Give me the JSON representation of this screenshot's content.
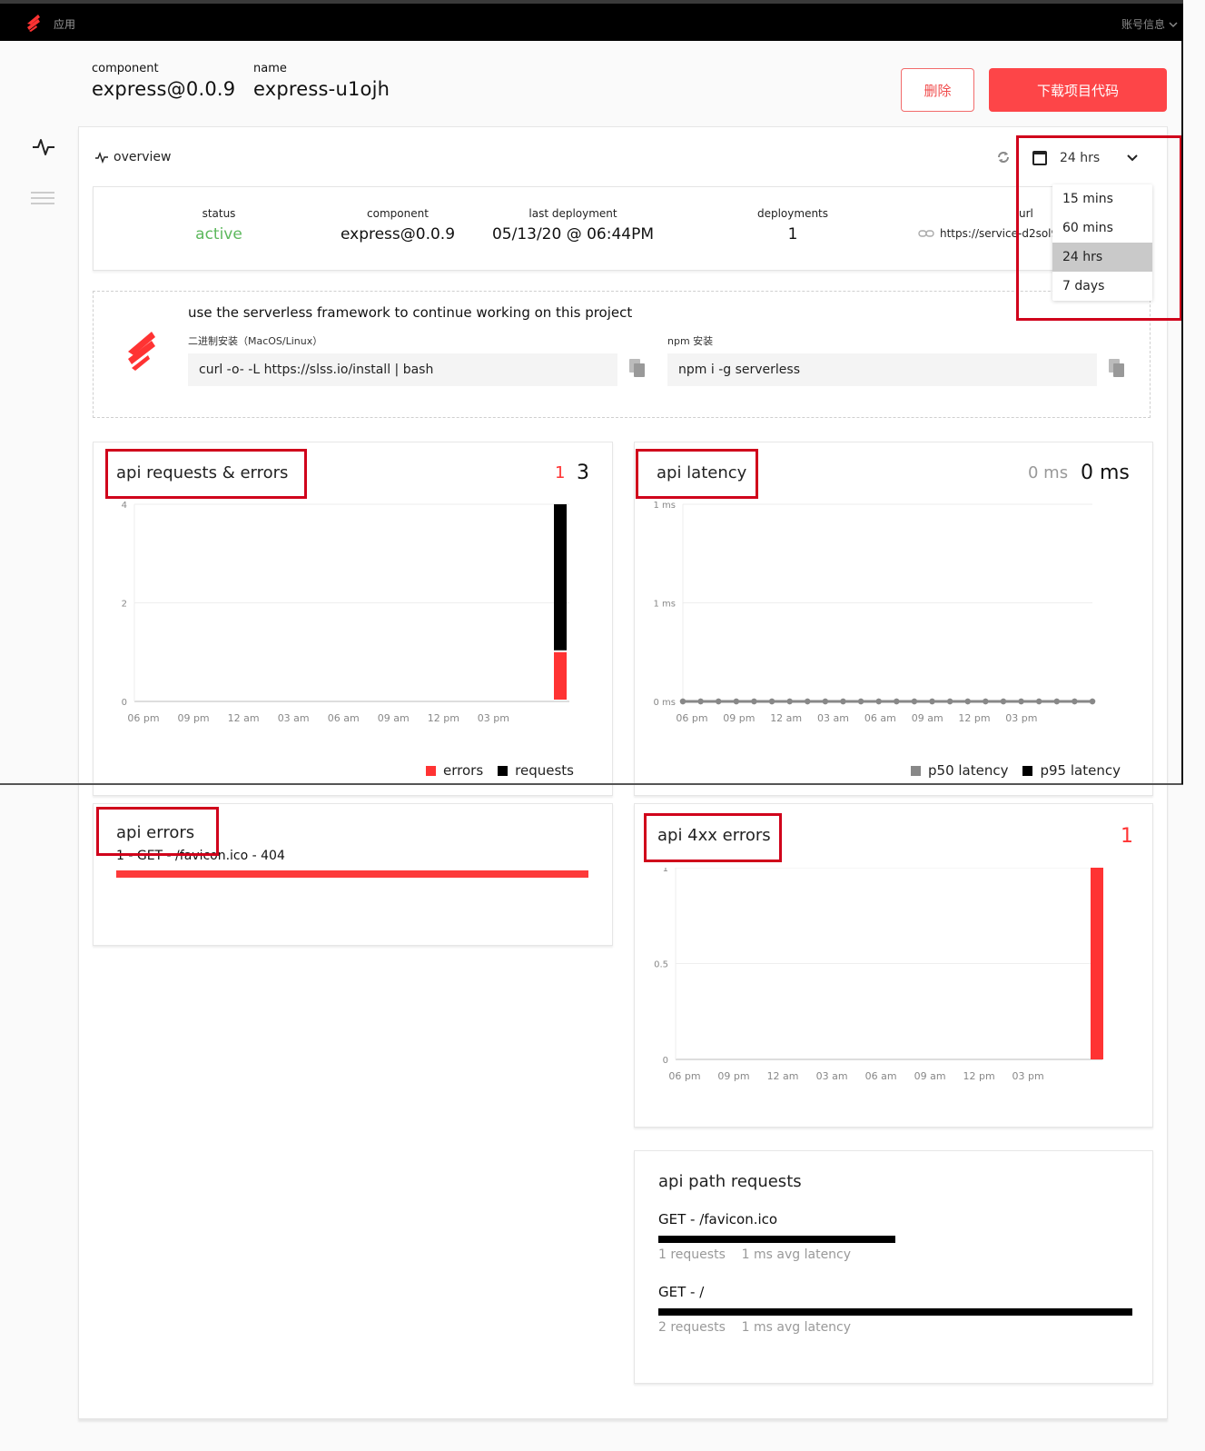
{
  "topbar": {
    "app_label": "应用",
    "account_label": "账号信息"
  },
  "header": {
    "component_label": "component",
    "component_value": "express@0.0.9",
    "name_label": "name",
    "name_value": "express-u1ojh",
    "delete_button": "删除",
    "download_button": "下载项目代码"
  },
  "sidebar": {
    "items": [
      {
        "icon": "pulse-icon",
        "active": true
      },
      {
        "icon": "menu-icon",
        "active": false
      }
    ]
  },
  "overview": {
    "title": "overview",
    "time_range": {
      "selected": "24 hrs",
      "options": [
        "15 mins",
        "60 mins",
        "24 hrs",
        "7 days"
      ]
    },
    "stats": {
      "status_label": "status",
      "status_value": "active",
      "component_label": "component",
      "component_value": "express@0.0.9",
      "last_deployment_label": "last deployment",
      "last_deployment_value": "05/13/20 @ 06:44PM",
      "deployments_label": "deployments",
      "deployments_value": "1",
      "url_label": "url",
      "url_value": "https://service-d2sol94"
    }
  },
  "install": {
    "heading": "use the serverless framework to continue working on this project",
    "binary_label": "二进制安装（MacOS/Linux）",
    "binary_command": "curl -o- -L https://slss.io/install | bash",
    "npm_label": "npm 安装",
    "npm_command": "npm i -g serverless"
  },
  "colors": {
    "accent": "#fd4548",
    "error": "#ff3333",
    "requests": "#000000",
    "p50": "#888888",
    "p95": "#000000",
    "status_active": "#5cb85c",
    "annotation": "#d0021b"
  },
  "cards": {
    "requests_errors": {
      "title": "api requests & errors",
      "errors_total": "1",
      "requests_total": "3"
    },
    "latency": {
      "title": "api latency",
      "p50_total": "0 ms",
      "p95_total": "0 ms"
    },
    "api_errors": {
      "title": "api errors",
      "rows": [
        {
          "label": "1 - GET - /favicon.ico - 404",
          "count": 1
        }
      ]
    },
    "errors_4xx": {
      "title": "api 4xx errors",
      "total": "1"
    },
    "path_requests": {
      "title": "api path requests",
      "paths": [
        {
          "name": "GET - /favicon.ico",
          "requests": 1,
          "meta": "1 requests    1 ms avg latency"
        },
        {
          "name": "GET - /",
          "requests": 2,
          "meta": "2 requests    1 ms avg latency"
        }
      ]
    }
  },
  "chart_data": [
    {
      "id": "requests_errors",
      "type": "bar",
      "title": "api requests & errors",
      "x_ticks": [
        "06 pm",
        "09 pm",
        "12 am",
        "03 am",
        "06 am",
        "09 am",
        "12 pm",
        "03 pm"
      ],
      "y_ticks": [
        "0",
        "2",
        "4"
      ],
      "ylim": [
        0,
        4
      ],
      "stacked": true,
      "series": [
        {
          "name": "errors",
          "color": "#ff3333",
          "points": [
            {
              "x": "latest",
              "value": 1
            }
          ]
        },
        {
          "name": "requests",
          "color": "#000000",
          "points": [
            {
              "x": "latest",
              "value": 3
            }
          ]
        }
      ],
      "legend": [
        "errors",
        "requests"
      ],
      "legend_position": "bottom-right"
    },
    {
      "id": "latency",
      "type": "line",
      "title": "api latency",
      "x_ticks": [
        "06 pm",
        "09 pm",
        "12 am",
        "03 am",
        "06 am",
        "09 am",
        "12 pm",
        "03 pm"
      ],
      "y_ticks": [
        "0 ms",
        "1 ms",
        "1 ms"
      ],
      "ylim": [
        0,
        1
      ],
      "points_count": 24,
      "series": [
        {
          "name": "p50 latency",
          "color": "#888888",
          "values": [
            0,
            0,
            0,
            0,
            0,
            0,
            0,
            0,
            0,
            0,
            0,
            0,
            0,
            0,
            0,
            0,
            0,
            0,
            0,
            0,
            0,
            0,
            0,
            0
          ]
        },
        {
          "name": "p95 latency",
          "color": "#000000",
          "values": [
            0,
            0,
            0,
            0,
            0,
            0,
            0,
            0,
            0,
            0,
            0,
            0,
            0,
            0,
            0,
            0,
            0,
            0,
            0,
            0,
            0,
            0,
            0,
            0
          ]
        }
      ],
      "legend": [
        "p50 latency",
        "p95 latency"
      ],
      "legend_position": "bottom-right"
    },
    {
      "id": "errors_4xx",
      "type": "bar",
      "title": "api 4xx errors",
      "x_ticks": [
        "06 pm",
        "09 pm",
        "12 am",
        "03 am",
        "06 am",
        "09 am",
        "12 pm",
        "03 pm"
      ],
      "y_ticks": [
        "0",
        "0.5",
        "1"
      ],
      "ylim": [
        0,
        1
      ],
      "series": [
        {
          "name": "4xx errors",
          "color": "#ff3333",
          "points": [
            {
              "x": "latest",
              "value": 1
            }
          ]
        }
      ]
    }
  ]
}
